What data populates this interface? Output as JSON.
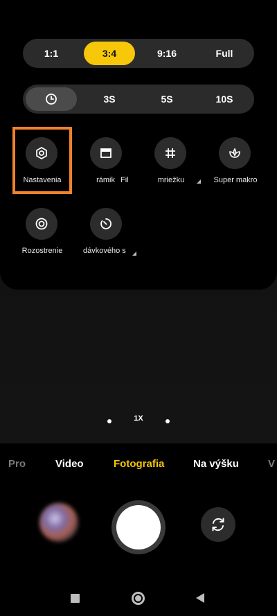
{
  "aspect_ratio": {
    "options": [
      "1:1",
      "3:4",
      "9:16",
      "Full"
    ],
    "selected": "3:4"
  },
  "timer": {
    "icon": "clock-icon",
    "options": [
      "3S",
      "5S",
      "10S"
    ]
  },
  "options_row1": [
    {
      "label": "Nastavenia",
      "icon": "settings-gear-icon"
    },
    {
      "label": "rámik",
      "icon": "frame-icon"
    },
    {
      "label": "Fil",
      "icon": "filter-icon"
    },
    {
      "label": "mriežku",
      "icon": "grid-icon"
    },
    {
      "label": "Super makro",
      "icon": "macro-flower-icon"
    }
  ],
  "options_row2": [
    {
      "label": "Rozostrenie",
      "icon": "blur-icon"
    },
    {
      "label": "dávkového s",
      "icon": "burst-timer-icon"
    }
  ],
  "zoom": {
    "label": "1X"
  },
  "modes": {
    "items": [
      "Pro",
      "Video",
      "Fotografia",
      "Na výšku",
      "V"
    ],
    "active": "Fotografia"
  },
  "colors": {
    "accent": "#f7c70a",
    "highlight": "#f2812a"
  }
}
